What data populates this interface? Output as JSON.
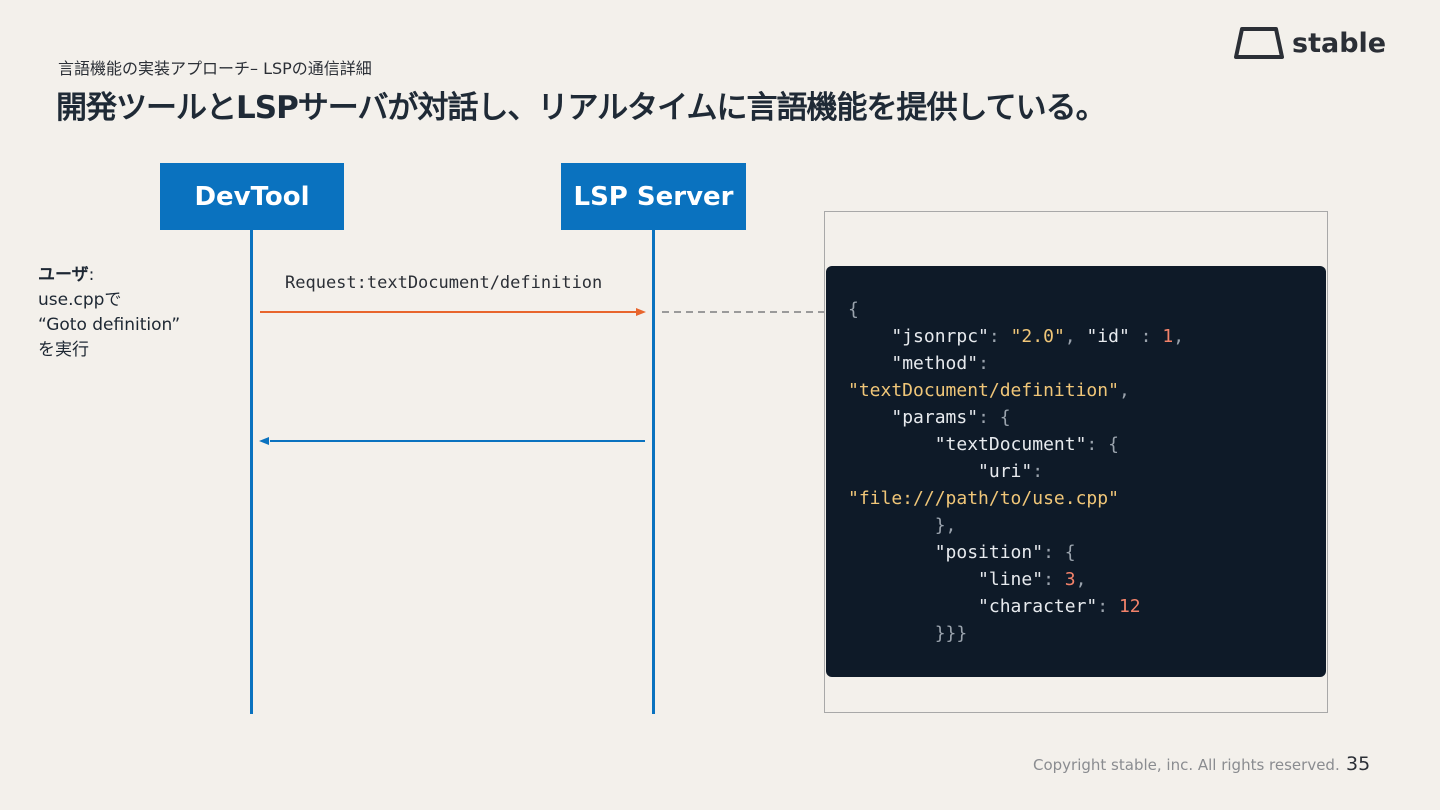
{
  "header": {
    "subtitle": "言語機能の実装アプローチ– LSPの通信詳細",
    "title": "開発ツールとLSPサーバが対話し、リアルタイムに言語機能を提供している。"
  },
  "logo": {
    "icon": "stable-logo-icon",
    "text": "stable"
  },
  "diagram": {
    "actors": [
      {
        "label": "DevTool"
      },
      {
        "label": "LSP Server"
      }
    ],
    "user_note": {
      "heading": "ユーザ",
      "lines": [
        "use.cppで",
        "“Goto definition”",
        "を実行"
      ]
    },
    "request_label": "Request:textDocument/definition",
    "colors": {
      "request_arrow": "#e8652d",
      "response_arrow": "#0a72bf",
      "actor": "#0a72bf"
    }
  },
  "code": {
    "open": "{",
    "jsonrpc_key": "\"jsonrpc\"",
    "jsonrpc_val": "\"2.0\"",
    "id_key": "\"id\"",
    "id_val": "1",
    "method_key": "\"method\"",
    "method_val": "\"textDocument/definition\"",
    "params_key": "\"params\"",
    "textdoc_key": "\"textDocument\"",
    "uri_key": "\"uri\"",
    "uri_val": "\"file:///path/to/use.cpp\"",
    "textdoc_close": "},",
    "position_key": "\"position\"",
    "line_key": "\"line\"",
    "line_val": "3",
    "char_key": "\"character\"",
    "char_val": "12",
    "close": "}}}"
  },
  "footer": {
    "copyright": "Copyright stable, inc. All rights reserved.",
    "page": "35"
  }
}
